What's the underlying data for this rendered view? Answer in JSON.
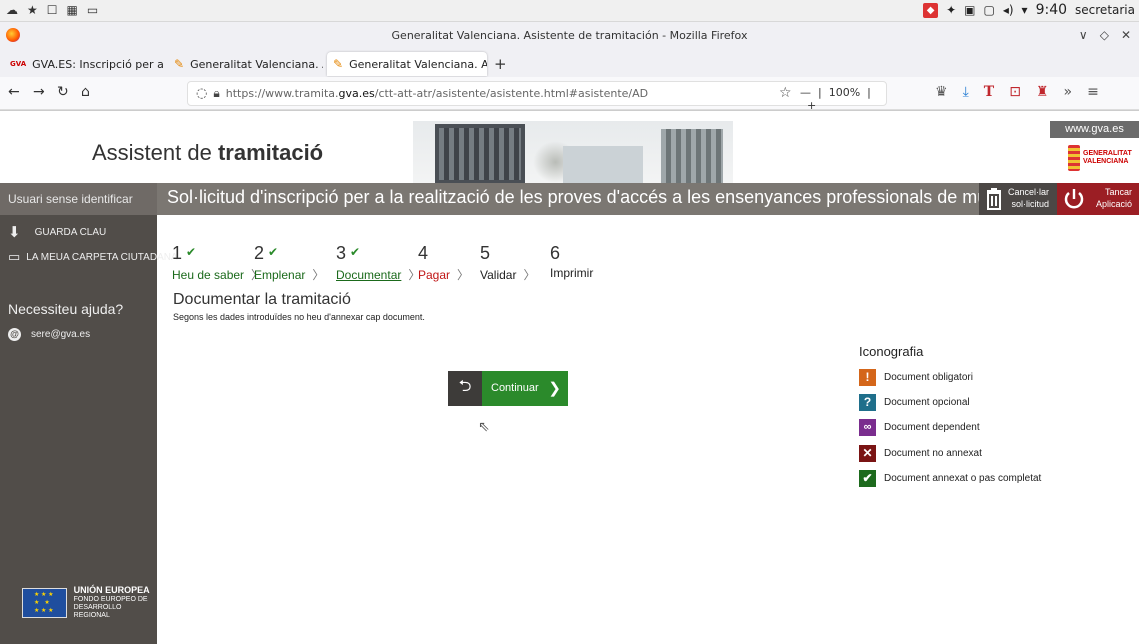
{
  "os": {
    "clock": "9:40",
    "user": "secretaria"
  },
  "firefox": {
    "window_title": "Generalitat Valenciana. Asistente de tramitación - Mozilla Firefox",
    "tabs": [
      {
        "label": "GVA.ES: Inscripció per a la",
        "favicon": "gva-favicon"
      },
      {
        "label": "Generalitat Valenciana. As",
        "favicon": "pencil-favicon"
      },
      {
        "label": "Generalitat Valenciana. As",
        "favicon": "pencil-favicon",
        "active": true
      }
    ],
    "url_prefix": "https://www.tramita.",
    "url_domain": "gva.es",
    "url_path": "/ctt-att-atr/asistente/asistente.html#asistente/AD",
    "zoom": "100%"
  },
  "header": {
    "brand_light": "Assistent de",
    "brand_bold": "tramitació",
    "gva_link": "www.gva.es",
    "gva_logo_line1": "GENERALITAT",
    "gva_logo_line2": "VALENCIANA"
  },
  "sidebar": {
    "user": "Usuari sense identificar",
    "save_key": "GUARDA CLAU",
    "folder": "LA MEUA CARPETA CIUTADANA",
    "help_title": "Necessiteu ajuda?",
    "email": "sere@gva.es",
    "eu_title": "UNIÓN EUROPEA",
    "eu_line1": "FONDO EUROPEO DE",
    "eu_line2": "DESARROLLO REGIONAL"
  },
  "titlebar": {
    "title": "Sol·licitud d'inscripció per a la realització de les proves d'accés a les ensenyances professionals de música i dansa",
    "cancel_line1": "Cancel·lar",
    "cancel_line2": "sol·licitud",
    "close_line1": "Tancar",
    "close_line2": "Aplicació"
  },
  "steps": [
    {
      "num": "1",
      "label": "Heu de saber",
      "done": true
    },
    {
      "num": "2",
      "label": "Emplenar",
      "done": true
    },
    {
      "num": "3",
      "label": "Documentar",
      "done": true,
      "current": true
    },
    {
      "num": "4",
      "label": "Pagar",
      "state": "pending-red"
    },
    {
      "num": "5",
      "label": "Validar"
    },
    {
      "num": "6",
      "label": "Imprimir"
    }
  ],
  "content": {
    "heading": "Documentar la tramitació",
    "text": "Segons les dades introduïdes no heu d'annexar cap document.",
    "continue": "Continuar"
  },
  "legend": {
    "title": "Iconografia",
    "items": [
      {
        "label": "Document obligatori",
        "icon": "exclamation-icon",
        "color": "#d4661a"
      },
      {
        "label": "Document opcional",
        "icon": "question-icon",
        "color": "#1f6f8b"
      },
      {
        "label": "Document dependent",
        "icon": "link-icon",
        "color": "#7a2d8e"
      },
      {
        "label": "Document no annexat",
        "icon": "cross-icon",
        "color": "#7a1414"
      },
      {
        "label": "Document annexat o pas completat",
        "icon": "check-icon",
        "color": "#1d6a1d"
      }
    ]
  }
}
